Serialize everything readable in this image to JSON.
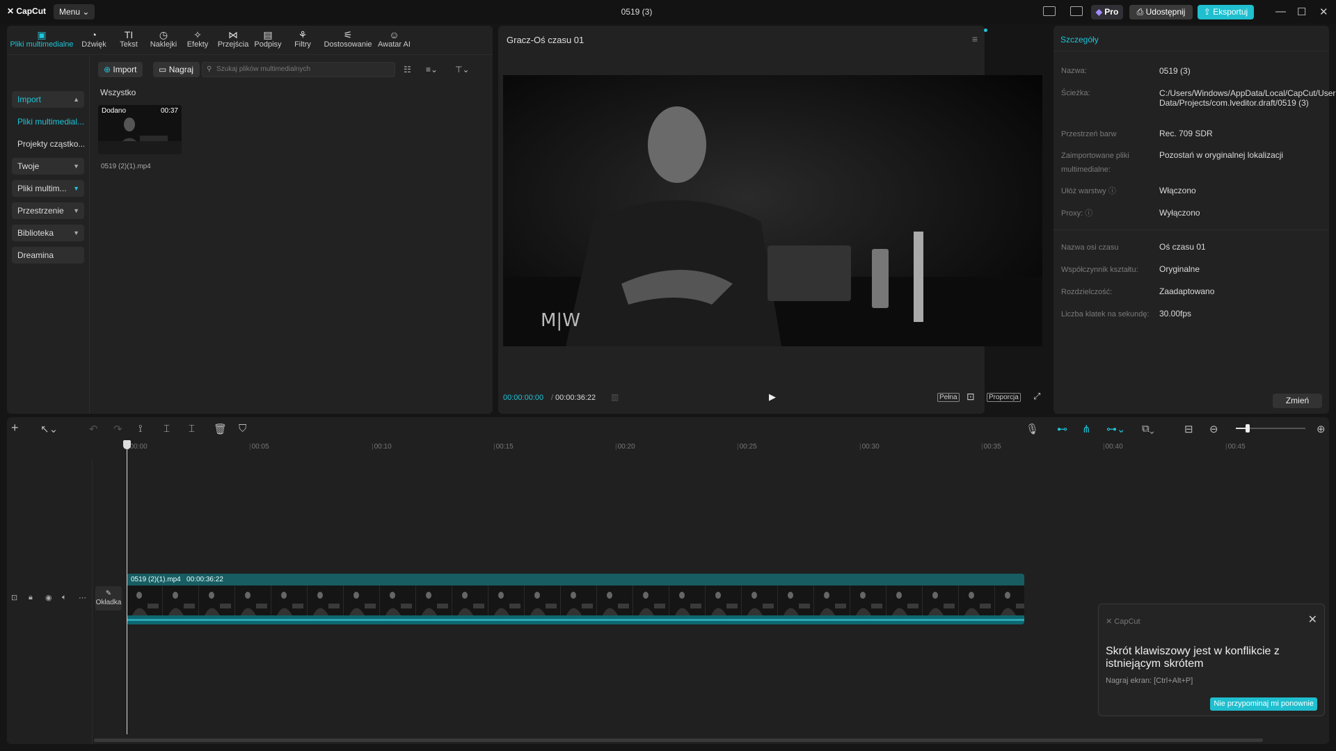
{
  "titlebar": {
    "logo": "CapCut",
    "menu": "Menu",
    "title": "0519 (3)",
    "pro": "Pro",
    "share": "Udostępnij",
    "export": "Eksportuj"
  },
  "tools": [
    {
      "label": "Pliki multimedialne",
      "icon": "media-icon"
    },
    {
      "label": "Dźwięk",
      "icon": "audio-icon"
    },
    {
      "label": "Tekst",
      "icon": "text-icon"
    },
    {
      "label": "Naklejki",
      "icon": "sticker-icon"
    },
    {
      "label": "Efekty",
      "icon": "effects-icon"
    },
    {
      "label": "Przejścia",
      "icon": "transitions-icon"
    },
    {
      "label": "Podpisy",
      "icon": "captions-icon"
    },
    {
      "label": "Filtry",
      "icon": "filters-icon"
    },
    {
      "label": "Dostosowanie",
      "icon": "adjust-icon"
    },
    {
      "label": "Awatar AI",
      "icon": "avatar-icon"
    }
  ],
  "sidebar": {
    "items": [
      {
        "label": "Import"
      },
      {
        "label": "Pliki multimedial..."
      },
      {
        "label": "Projekty cząstko..."
      },
      {
        "label": "Twoje"
      },
      {
        "label": "Pliki multim..."
      },
      {
        "label": "Przestrzenie"
      },
      {
        "label": "Biblioteka"
      },
      {
        "label": "Dreamina"
      }
    ]
  },
  "media": {
    "import_btn": "Import",
    "record_btn": "Nagraj",
    "search_placeholder": "Szukaj plików multimedialnych",
    "filter_all": "Wszystko",
    "thumb_added": "Dodano",
    "thumb_duration": "00:37",
    "thumb_name": "0519 (2)(1).mp4"
  },
  "player": {
    "title": "Gracz-Oś czasu 01",
    "watermark": "M|W",
    "current_time": "00:00:00:00",
    "total_time": "00:00:36:22",
    "full_label": "Pełna",
    "ratio_label": "Proporcja"
  },
  "details": {
    "title": "Szczegóły",
    "rows": [
      {
        "label": "Nazwa:",
        "value": "0519 (3)"
      },
      {
        "label": "Ścieżka:",
        "value": "C:/Users/Windows/AppData/Local/CapCut/User Data/Projects/com.lveditor.draft/0519 (3)"
      },
      {
        "label": "Przestrzeń barw",
        "value": "Rec. 709 SDR"
      },
      {
        "label": "Zaimportowane pliki multimedialne:",
        "value": "Pozostań w oryginalnej lokalizacji"
      },
      {
        "label": "Ułóż warstwy ⓘ",
        "value": "Włączono"
      },
      {
        "label": "Proxy: ⓘ",
        "value": "Wyłączono"
      },
      {
        "label": "Nazwa osi czasu",
        "value": "Oś czasu 01"
      },
      {
        "label": "Współczynnik kształtu:",
        "value": "Oryginalne"
      },
      {
        "label": "Rozdzielczość:",
        "value": "Zaadaptowano"
      },
      {
        "label": "Liczba klatek na sekundę:",
        "value": "30.00fps"
      }
    ],
    "change_btn": "Zmień"
  },
  "timeline": {
    "ticks": [
      "00:00",
      "00:05",
      "00:10",
      "00:15",
      "00:20",
      "00:25",
      "00:30",
      "00:35",
      "00:40",
      "00:45"
    ],
    "cover_label": "Okładka",
    "clip_name": "0519 (2)(1).mp4",
    "clip_duration": "00:00:36:22"
  },
  "toast": {
    "app": "CapCut",
    "message": "Skrót klawiszowy jest w konflikcie z istniejącym skrótem",
    "sub": "Nagraj ekran: [Ctrl+Alt+P]",
    "button": "Nie przypominaj mi ponownie"
  },
  "colors": {
    "accent": "#1fc4d8",
    "clip": "#18757c",
    "background": "#151515",
    "panel": "#222222"
  }
}
